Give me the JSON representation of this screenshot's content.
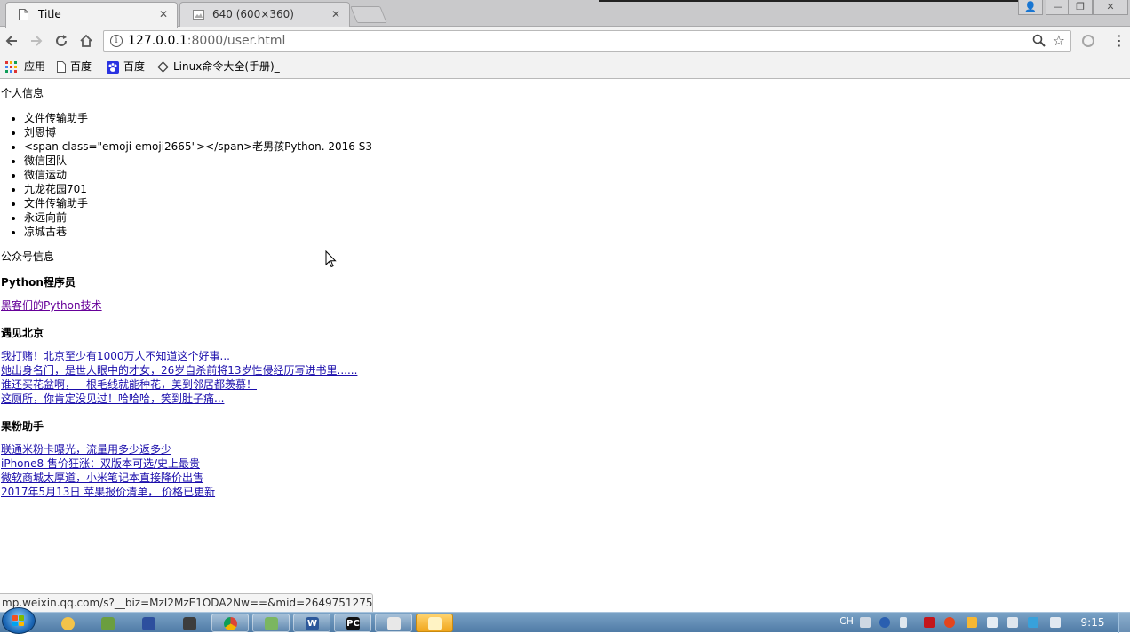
{
  "browser": {
    "tabs": [
      {
        "title": "Title",
        "active": true
      },
      {
        "title": "640 (600×360)",
        "active": false
      }
    ],
    "tab_close_glyph": "✕",
    "window_controls": {
      "user": "👤",
      "minimize": "—",
      "restore": "❐",
      "close": "✕"
    },
    "address_bar": {
      "host": "127.0.0.1",
      "path": ":8000/user.html"
    },
    "bookmarks": [
      {
        "label": "应用",
        "icon": "apps-grid-icon"
      },
      {
        "label": "百度",
        "icon": "page-icon"
      },
      {
        "label": "百度",
        "icon": "paw-icon"
      },
      {
        "label": "Linux命令大全(手册)_",
        "icon": "bookmark-diamond-icon"
      }
    ],
    "status_url": "mp.weixin.qq.com/s?__biz=MzI2MzE1ODA2Nw==&mid=2649751275..."
  },
  "page": {
    "personal_section_title": "个人信息",
    "contacts": [
      "文件传输助手",
      "刘恩博",
      "<span class=\"emoji emoji2665\"></span>老男孩Python. 2016 S3",
      "微信团队",
      "微信运动",
      "九龙花园701",
      "文件传输助手",
      "永远向前",
      "凉城古巷"
    ],
    "public_section_title": "公众号信息",
    "accounts": [
      {
        "name": "Python程序员",
        "articles": [
          "黑客们的Python技术"
        ]
      },
      {
        "name": "遇见北京",
        "articles": [
          "我打赌！北京至少有1000万人不知道这个好事...",
          "她出身名门，是世人眼中的才女，26岁自杀前将13岁性侵经历写进书里......",
          "谁还买花盆啊，一根毛线就能种花，美到邻居都羡慕！",
          "这厕所，你肯定没见过！哈哈哈，笑到肚子痛..."
        ]
      },
      {
        "name": "果粉助手",
        "articles": [
          "联通米粉卡曝光，流量用多少返多少",
          "iPhone8 售价狂涨：双版本可选/史上最贵",
          "微软商城太厚道，小米笔记本直接降价出售",
          "2017年5月13日 苹果报价清单， 价格已更新"
        ]
      }
    ]
  },
  "taskbar": {
    "language": "CH",
    "clock": "9:15"
  },
  "colors": {
    "link": "#1a0dab",
    "visited_link": "#660099",
    "taskbar": "#5a86b0"
  }
}
